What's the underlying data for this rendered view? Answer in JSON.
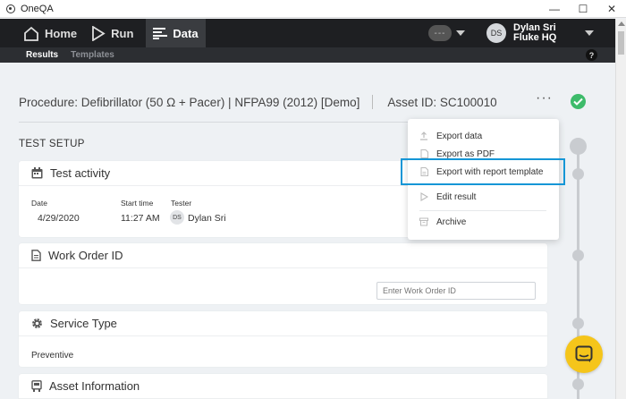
{
  "window": {
    "title": "OneQA"
  },
  "nav": {
    "home_label": "Home",
    "run_label": "Run",
    "data_label": "Data",
    "status_text": "---",
    "user_initials": "DS",
    "user_name": "Dylan Sri",
    "user_site": "Fluke HQ"
  },
  "subnav": {
    "results_label": "Results",
    "templates_label": "Templates",
    "help_label": "?"
  },
  "procedure": {
    "title": "Procedure: Defibrillator (50 Ω + Pacer) | NFPA99 (2012) [Demo]",
    "asset_id": "Asset ID: SC100010",
    "more_label": "···"
  },
  "section": {
    "test_setup": "TEST SETUP"
  },
  "test_activity": {
    "title": "Test activity",
    "date_label": "Date",
    "date_value": "4/29/2020",
    "start_label": "Start time",
    "start_value": "11:27 AM",
    "tester_label": "Tester",
    "tester_initials": "DS",
    "tester_name": "Dylan Sri"
  },
  "work_order": {
    "title": "Work Order ID",
    "placeholder": "Enter Work Order ID"
  },
  "service_type": {
    "title": "Service Type",
    "value": "Preventive"
  },
  "asset_info": {
    "title": "Asset Information"
  },
  "menu": {
    "items": [
      {
        "label": "Export data"
      },
      {
        "label": "Export as PDF"
      },
      {
        "label": "Export with report template"
      },
      {
        "label": "Edit result"
      },
      {
        "label": "Archive"
      }
    ]
  },
  "colors": {
    "accent_blue": "#1596d6",
    "success_green": "#3dbb6a",
    "chat_yellow": "#f5c51a",
    "nav_dark": "#1e1f22"
  }
}
